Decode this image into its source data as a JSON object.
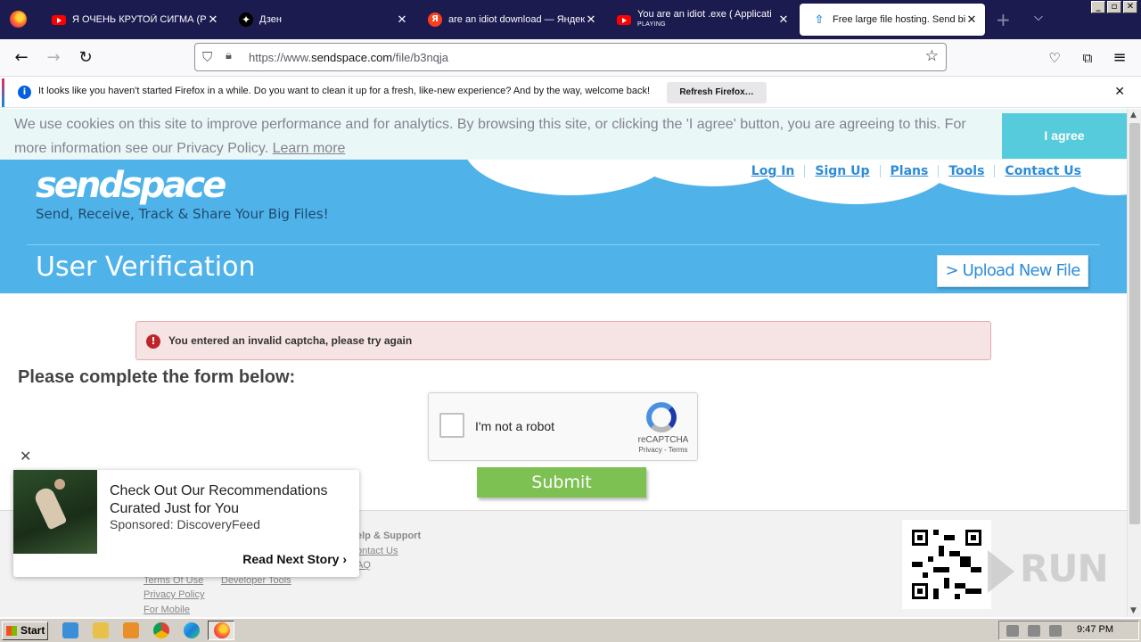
{
  "browser": {
    "tabs": [
      {
        "title": "Я ОЧЕНЬ КРУТОЙ СИГМА (РНС",
        "icon": "youtube-icon"
      },
      {
        "title": "Дзен",
        "icon": "dzen-icon"
      },
      {
        "title": "are an idiot download — Яндекс",
        "icon": "yandex-icon"
      },
      {
        "title": "You are an idiot .exe ( Applicati",
        "subtitle": "PLAYING",
        "icon": "youtube-icon"
      },
      {
        "title": "Free large file hosting. Send big",
        "icon": "sendspace-icon",
        "active": true
      }
    ],
    "url_prefix": "https://www.",
    "url_domain": "sendspace.com",
    "url_path": "/file/b3nqja",
    "notification": {
      "message": "It looks like you haven't started Firefox in a while. Do you want to clean it up for a fresh, like-new experience? And by the way, welcome back!",
      "button": "Refresh Firefox…"
    }
  },
  "cookie_banner": {
    "text": "We use cookies on this site to improve performance and for analytics. By browsing this site, or clicking the 'I agree' button, you are agreeing to this. For more information see our Privacy Policy.",
    "learn_more": "Learn more",
    "agree": "I agree"
  },
  "site": {
    "logo_part1": "send",
    "logo_part2": "space",
    "tagline": "Send, Receive, Track & Share Your Big Files!",
    "nav": [
      "Log In",
      "Sign Up",
      "Plans",
      "Tools",
      "Contact Us"
    ],
    "page_title": "User Verification",
    "upload_button": "> Upload New File"
  },
  "error": {
    "message": "You entered an invalid captcha, please try again"
  },
  "form": {
    "title": "Please complete the form below:",
    "captcha_label": "I'm not a robot",
    "captcha_brand": "reCAPTCHA",
    "captcha_links": "Privacy - Terms",
    "submit": "Submit"
  },
  "footer": {
    "help_heading": "elp & Support",
    "help_links": [
      "ontact Us",
      "AQ"
    ],
    "links": [
      "Terms Of Use",
      "Privacy Policy",
      "For Mobile",
      "Developer Tools"
    ],
    "watermark": "RUN"
  },
  "ad": {
    "headline": "Check Out Our Recommendations Curated Just for You",
    "sponsor": "Sponsored: DiscoveryFeed",
    "cta": "Read Next Story"
  },
  "taskbar": {
    "start": "Start",
    "clock": "9:47 PM"
  },
  "colors": {
    "tab_bar": "#1c1b4f",
    "header_blue": "#4fb3ea",
    "link_blue": "#2d8cd6",
    "agree_teal": "#56cbdb",
    "submit_green": "#7dc152",
    "error_bg": "#f6e4e4"
  }
}
